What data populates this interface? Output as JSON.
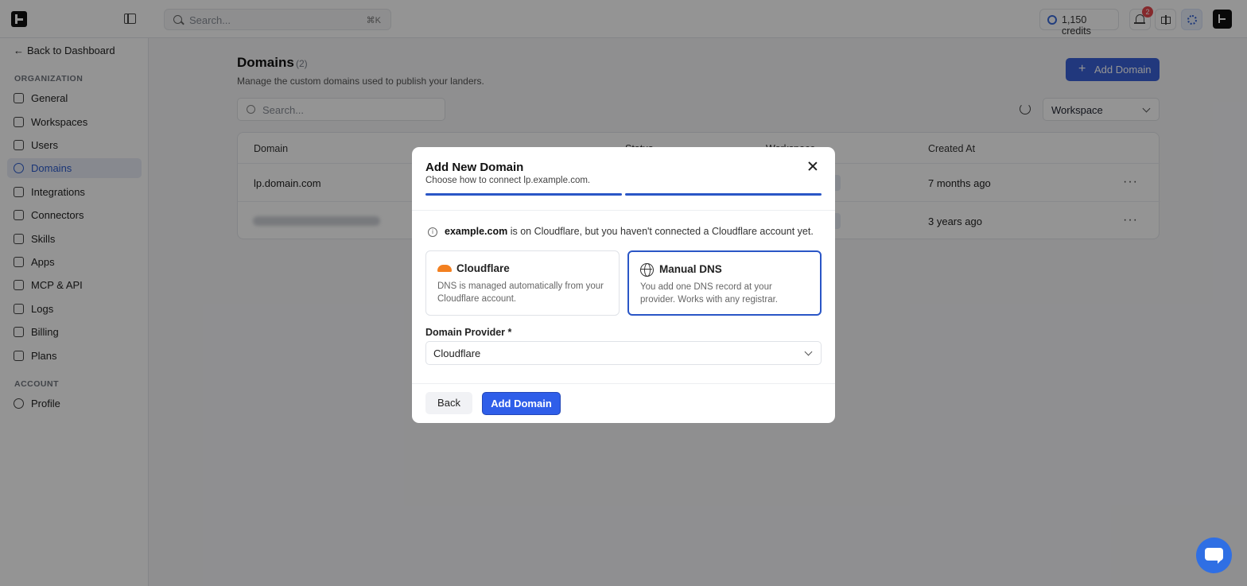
{
  "topbar": {
    "search_placeholder": "Search...",
    "search_shortcut": "⌘K",
    "credits": "1,150 credits",
    "notifications_count": "2"
  },
  "sidebar": {
    "back_label": "Back to Dashboard",
    "org_section": "ORGANIZATION",
    "account_section": "ACCOUNT",
    "items": [
      {
        "label": "General",
        "icon": "gear-icon"
      },
      {
        "label": "Workspaces",
        "icon": "layers-icon"
      },
      {
        "label": "Users",
        "icon": "users-icon"
      },
      {
        "label": "Domains",
        "icon": "globe-icon"
      },
      {
        "label": "Integrations",
        "icon": "grid-icon"
      },
      {
        "label": "Connectors",
        "icon": "share-icon"
      },
      {
        "label": "Skills",
        "icon": "book-icon"
      },
      {
        "label": "Apps",
        "icon": "folder-icon"
      },
      {
        "label": "MCP & API",
        "icon": "key-icon"
      },
      {
        "label": "Logs",
        "icon": "file-icon"
      },
      {
        "label": "Billing",
        "icon": "credit-card-icon"
      },
      {
        "label": "Plans",
        "icon": "list-icon"
      }
    ],
    "account_items": [
      {
        "label": "Profile",
        "icon": "user-icon"
      }
    ],
    "active": "Domains"
  },
  "main": {
    "title": "Domains",
    "count": "(2)",
    "subtitle": "Manage the custom domains used to publish your landers.",
    "add_button": "Add Domain",
    "search_placeholder": "Search...",
    "workspace_select": "Workspace",
    "table": {
      "columns": [
        "Domain",
        "Status",
        "Workspace",
        "Created At"
      ],
      "rows": [
        {
          "domain": "lp.domain.com",
          "created": "7 months ago"
        },
        {
          "domain": "",
          "created": "3 years ago"
        }
      ]
    }
  },
  "modal": {
    "title": "Add New Domain",
    "subtitle": "Choose how to connect lp.example.com.",
    "info_domain": "example.com",
    "info_text": " is on Cloudflare, but you haven't connected a Cloudflare account yet.",
    "options": [
      {
        "title": "Cloudflare",
        "desc": "DNS is managed automatically from your Cloudflare account."
      },
      {
        "title": "Manual DNS",
        "desc": "You add one DNS record at your provider. Works with any registrar."
      }
    ],
    "selected_option": "Manual DNS",
    "provider_label": "Domain Provider *",
    "provider_value": "Cloudflare",
    "back_button": "Back",
    "submit_button": "Add Domain"
  },
  "colors": {
    "accent": "#2f5ee9",
    "cloudflare": "#f38020"
  }
}
